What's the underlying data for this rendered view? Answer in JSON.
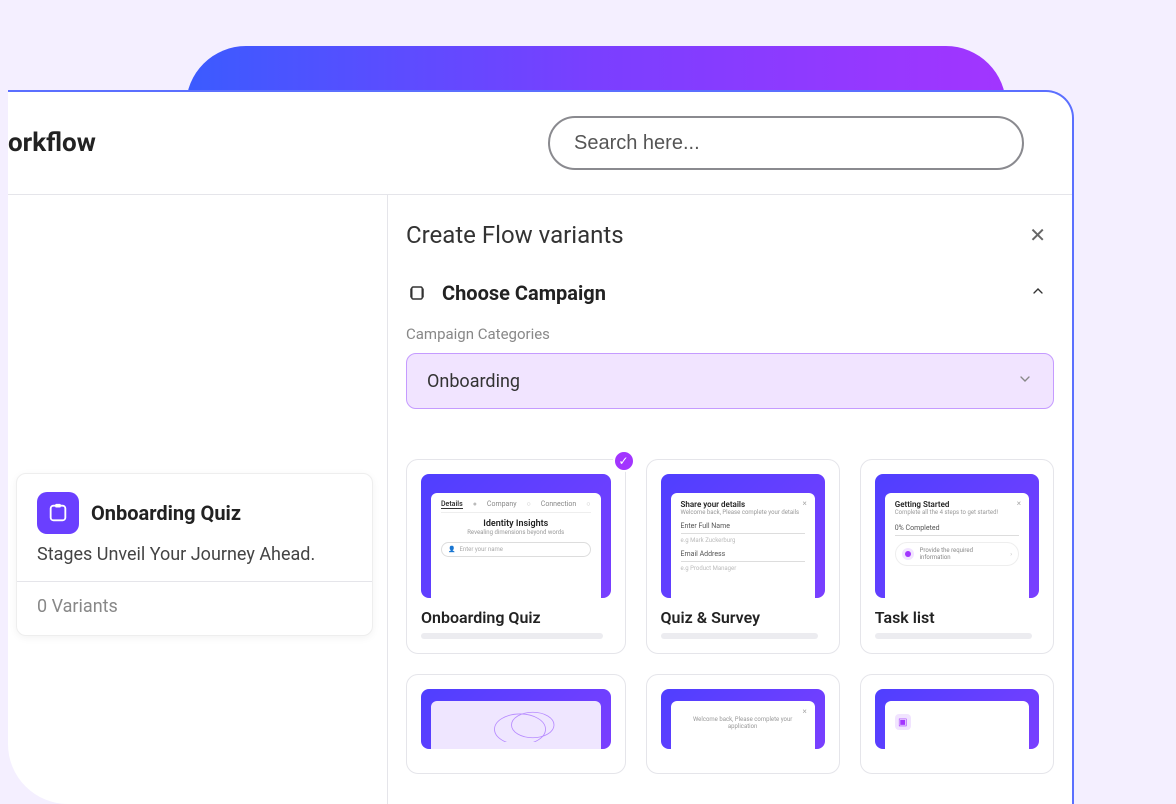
{
  "window": {
    "title": "orkflow"
  },
  "search": {
    "placeholder": "Search here..."
  },
  "sidebar_card": {
    "title": "Onboarding Quiz",
    "subtitle": "Stages Unveil Your Journey Ahead.",
    "variants": "0 Variants"
  },
  "panel": {
    "title": "Create Flow variants",
    "step_title": "Choose Campaign",
    "category_label": "Campaign Categories",
    "selected_category": "Onboarding"
  },
  "templates": [
    {
      "name": "Onboarding Quiz",
      "selected": true
    },
    {
      "name": "Quiz & Survey",
      "selected": false
    },
    {
      "name": "Task list",
      "selected": false
    }
  ],
  "preview": {
    "quiz": {
      "tabs": [
        "Details",
        "Company",
        "Connection"
      ],
      "heading": "Identity Insights",
      "sub": "Revealing dimensions beyond words",
      "field": "Enter your name"
    },
    "survey": {
      "heading": "Share your details",
      "sub": "Welcome back, Please complete your details",
      "label1": "Enter Full Name",
      "ph1": "e.g Mark Zuckerburg",
      "label2": "Email Address",
      "ph2": "e.g Product Manager"
    },
    "task": {
      "heading": "Getting Started",
      "sub": "Complete all the 4 steps to get started!",
      "progress": "0% Completed",
      "item": "Provide the required information"
    },
    "row2b_sub": "Welcome back, Please complete your application"
  }
}
